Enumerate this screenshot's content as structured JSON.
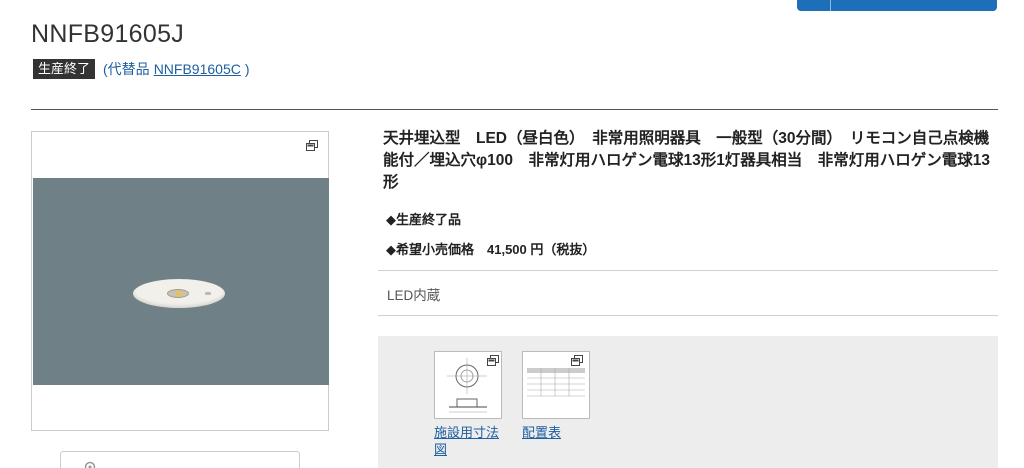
{
  "product": {
    "code": "NNFB91605J",
    "status_badge": "生産終了",
    "alternative_prefix": "(代替品",
    "alternative_code": "NNFB91605C",
    "alternative_suffix": ")"
  },
  "description": "天井埋込型　LED（昼白色）　非常用照明器具　一般型（30分間）　リモコン自己点検機能付／埋込穴φ100　非常灯用ハロゲン電球13形1灯器具相当　非常灯用ハロゲン電球13形",
  "info": {
    "status_line": "◆生産終了品",
    "price_line": "◆希望小売価格　41,500 円（税抜）"
  },
  "feature": "LED内蔵",
  "documents": [
    {
      "label": "施設用寸法図"
    },
    {
      "label": "配置表"
    }
  ],
  "icons": {
    "expand": "expand-icon",
    "gear": "gear-icon"
  },
  "colors": {
    "accent": "#1e6fba",
    "link": "#1d5fa0",
    "badge_bg": "#333333",
    "image_bg": "#6f8087",
    "panel_bg": "#ededed"
  }
}
